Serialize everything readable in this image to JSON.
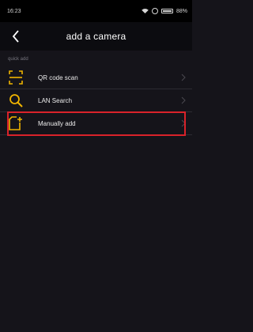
{
  "status_bar": {
    "time": "16:23",
    "battery": "88%"
  },
  "header": {
    "title": "add a camera"
  },
  "section": {
    "label": "quick add"
  },
  "items": [
    {
      "label": "QR code scan"
    },
    {
      "label": "LAN Search"
    },
    {
      "label": "Manually add"
    }
  ],
  "colors": {
    "accent": "#f0b400",
    "highlight": "#d9222a",
    "background": "#15141a"
  }
}
